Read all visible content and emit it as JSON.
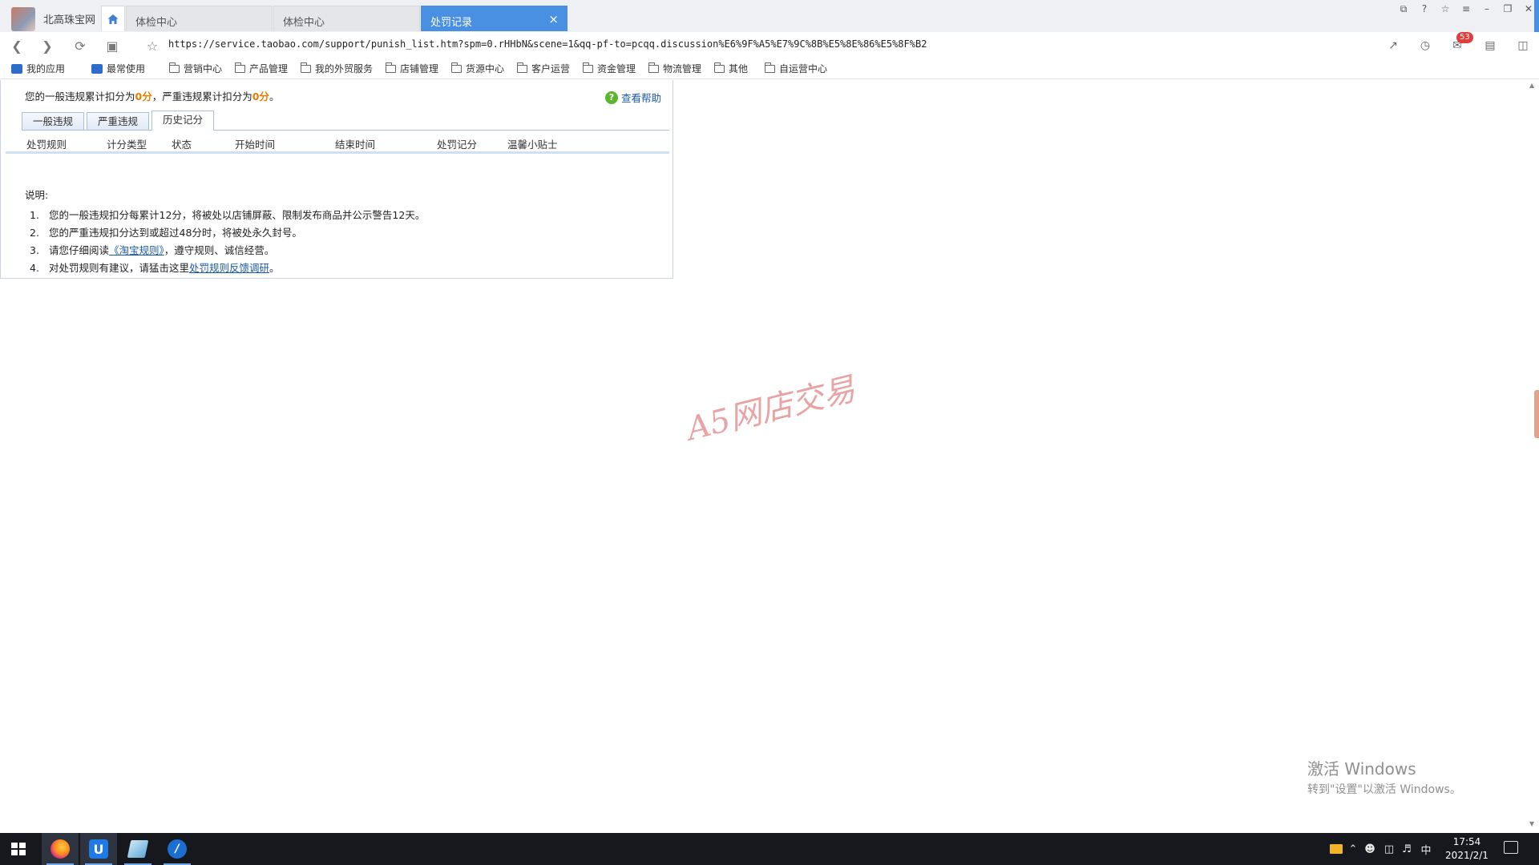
{
  "browser": {
    "profile_name": "北高珠宝网",
    "tabs": [
      {
        "label": "体检中心"
      },
      {
        "label": "体检中心"
      },
      {
        "label": "处罚记录",
        "active": true
      }
    ],
    "tab_close": "×",
    "window_controls": [
      "⧉",
      "?",
      "☆",
      "≡",
      "–",
      "❐",
      "✕"
    ],
    "url": "https://service.taobao.com/support/punish_list.htm?spm=0.rHHbN&scene=1&qq-pf-to=pcqq.discussion%E6%9F%A5%E7%9C%8B%E5%8E%86%E5%8F%B2",
    "mail_count": "53",
    "accent_color": "#4a90e2"
  },
  "bookmarks": [
    {
      "label": "我的应用",
      "icon": "app-box-icon"
    },
    {
      "label": "最常使用",
      "icon": "app-box-icon"
    },
    {
      "label": "营销中心",
      "icon": "folder-icon"
    },
    {
      "label": "产品管理",
      "icon": "folder-icon"
    },
    {
      "label": "我的外贸服务",
      "icon": "folder-icon"
    },
    {
      "label": "店铺管理",
      "icon": "folder-icon"
    },
    {
      "label": "货源中心",
      "icon": "folder-icon"
    },
    {
      "label": "客户运营",
      "icon": "folder-icon"
    },
    {
      "label": "资金管理",
      "icon": "folder-icon"
    },
    {
      "label": "物流管理",
      "icon": "folder-icon"
    },
    {
      "label": "其他",
      "icon": "folder-icon"
    },
    {
      "label": "自运营中心",
      "icon": "folder-icon"
    }
  ],
  "page": {
    "summary_prefix": "您的一般违规累计扣分为",
    "general_score": "0分",
    "summary_middle": "，严重违规累计扣分为",
    "severe_score": "0分",
    "summary_suffix": "。",
    "help_label": "查看帮助",
    "tabs": [
      {
        "label": "一般违规"
      },
      {
        "label": "严重违规"
      },
      {
        "label": "历史记分",
        "active": true
      }
    ],
    "columns": [
      "处罚规则",
      "计分类型",
      "状态",
      "开始时间",
      "结束时间",
      "处罚记分",
      "温馨小贴士"
    ],
    "notes_title": "说明:",
    "notes": [
      {
        "num": "1.",
        "text": "您的一般违规扣分每累计12分，将被处以店铺屏蔽、限制发布商品并公示警告12天。"
      },
      {
        "num": "2.",
        "text": "您的严重违规扣分达到或超过48分时，将被处永久封号。"
      },
      {
        "num": "3.",
        "pre": "请您仔细阅读",
        "link": "《淘宝规则》",
        "post": "，遵守规则、诚信经营。"
      },
      {
        "num": "4.",
        "pre": "对处罚规则有建议，请猛击这里",
        "link": "处罚规则反馈调研",
        "post": "。"
      }
    ]
  },
  "watermark": "A5网店交易",
  "os": {
    "activate_line1": "激活 Windows",
    "activate_line2": "转到\"设置\"以激活 Windows。",
    "tray_ime": "中",
    "time": "17:54",
    "date": "2021/2/1"
  }
}
